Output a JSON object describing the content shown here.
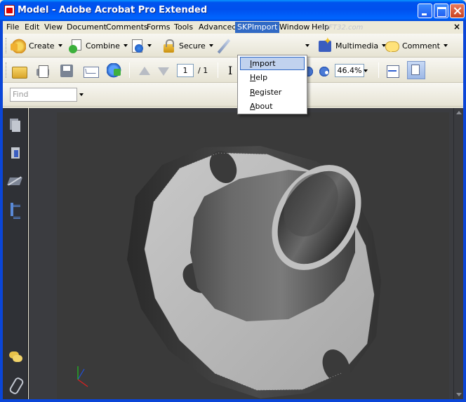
{
  "window": {
    "title": "Model - Adobe Acrobat Pro Extended",
    "title_color": "#0053ee"
  },
  "menubar": {
    "items": [
      "File",
      "Edit",
      "View",
      "Document",
      "Comments",
      "Forms",
      "Tools",
      "Advanced",
      "SKPImport",
      "Window",
      "Help"
    ],
    "active": "SKPImport",
    "close_glyph": "×",
    "watermark": "SOFT32.com"
  },
  "dropdown": {
    "items": [
      {
        "label": "Import",
        "mnemonic": "I",
        "rest": "mport",
        "hover": true
      },
      {
        "label": "Help",
        "mnemonic": "H",
        "rest": "elp",
        "hover": false
      },
      {
        "label": "Register",
        "mnemonic": "R",
        "rest": "egister",
        "hover": false
      },
      {
        "label": "About",
        "mnemonic": "A",
        "rest": "bout",
        "hover": false
      }
    ],
    "highlight_color": "#c1d2ee"
  },
  "toolbar_tasks": {
    "create": "Create",
    "combine": "Combine",
    "secure": "Secure",
    "multimedia": "Multimedia",
    "comment": "Comment"
  },
  "toolbar_file": {
    "page_current": "1",
    "page_total": "/ 1",
    "zoom": "46.4%"
  },
  "find": {
    "placeholder": "Find"
  },
  "colors": {
    "canvas_bg": "#3a3a3a",
    "nav_bg": "#2f3136",
    "model_light": "#bdbdbd",
    "model_dark": "#4a4a4a"
  }
}
